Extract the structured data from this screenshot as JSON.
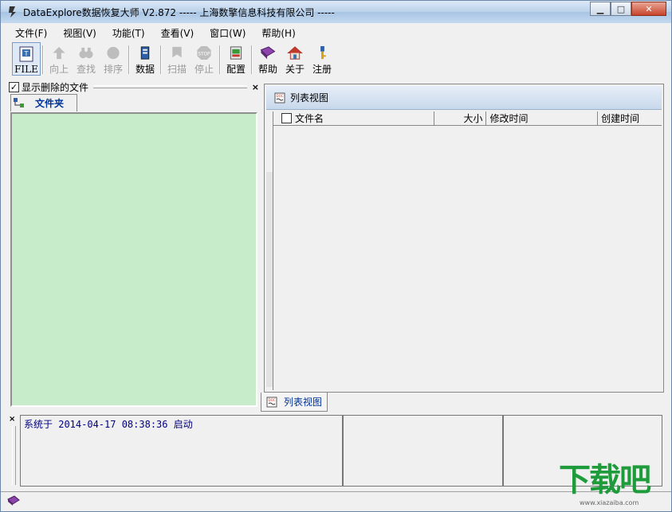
{
  "window": {
    "title": "DataExplore数据恢复大师 V2.872  ----- 上海数擎信息科技有限公司 -----",
    "controls": {
      "minimize": "▁",
      "maximize": "□",
      "close": "✕"
    }
  },
  "menu": {
    "items": [
      "文件(F)",
      "视图(V)",
      "功能(T)",
      "查看(V)",
      "窗口(W)",
      "帮助(H)"
    ]
  },
  "toolbar": {
    "file": "FILE",
    "up": "向上",
    "find": "查找",
    "sort": "排序",
    "data": "数据",
    "scan": "扫描",
    "stop": "停止",
    "config": "配置",
    "help": "帮助",
    "about": "关于",
    "register": "注册"
  },
  "left_panel": {
    "checkbox_label": "显示删除的文件",
    "checkbox_checked": true,
    "tab_label": "文件夹",
    "close": "×"
  },
  "right_panel": {
    "header_label": "列表视图",
    "columns": [
      "文件名",
      "大小",
      "修改时间",
      "创建时间"
    ],
    "bottom_tab_label": "列表视图"
  },
  "log": {
    "close": "×",
    "line1": "系统于 2014-04-17 08:38:36 启动"
  },
  "watermark": {
    "brand": "下载吧",
    "url": "www.xiazaiba.com"
  },
  "colors": {
    "tree_background": "#c6ecc9",
    "accent_blue": "#003399",
    "watermark_green": "#1e9b3a"
  }
}
